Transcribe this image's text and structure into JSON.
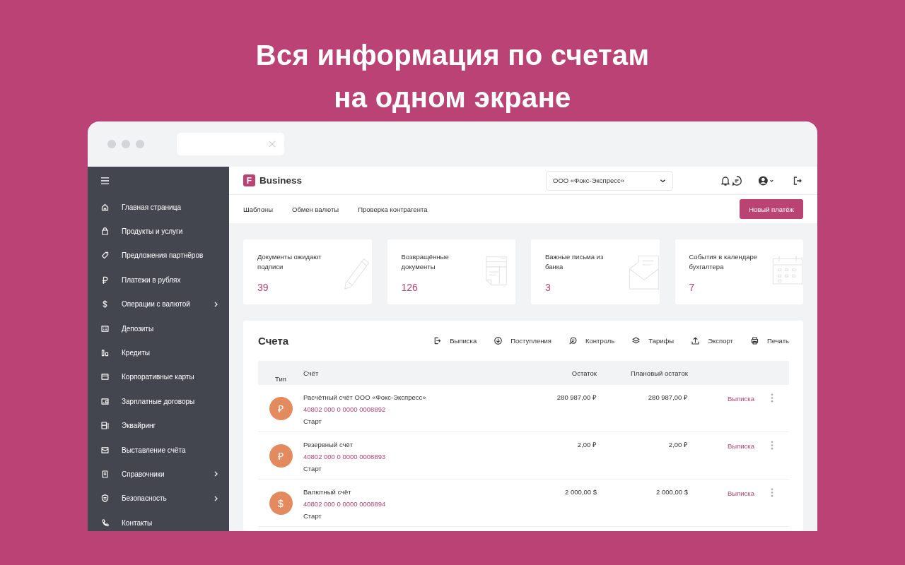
{
  "headline": [
    "Вся информация по счетам",
    "на одном экране"
  ],
  "sidebar": {
    "items": [
      {
        "label": "Главная страница",
        "has_submenu": false
      },
      {
        "label": "Продукты и услуги",
        "has_submenu": false
      },
      {
        "label": "Предложения партнёров",
        "has_submenu": false
      },
      {
        "label": "Платежи в рублях",
        "has_submenu": false
      },
      {
        "label": "Операции с валютой",
        "has_submenu": true
      },
      {
        "label": "Депозиты",
        "has_submenu": false
      },
      {
        "label": "Кредиты",
        "has_submenu": false
      },
      {
        "label": "Корпоративные карты",
        "has_submenu": false
      },
      {
        "label": "Зарплатные договоры",
        "has_submenu": false
      },
      {
        "label": "Эквайринг",
        "has_submenu": false
      },
      {
        "label": "Выставление счёта",
        "has_submenu": false
      },
      {
        "label": "Справочники",
        "has_submenu": true
      },
      {
        "label": "Безопасность",
        "has_submenu": true
      },
      {
        "label": "Контакты",
        "has_submenu": false
      }
    ]
  },
  "header": {
    "logo_mark": "F",
    "brand": "Business",
    "company_select": {
      "value": "ООО «Фокс-Экспресс»"
    }
  },
  "nav": {
    "links": [
      "Шаблоны",
      "Обмен валюты",
      "Проверка контрагента"
    ],
    "primary_button": "Новый платёж"
  },
  "cards": [
    {
      "label": "Документы ожидают подписи",
      "count": "39"
    },
    {
      "label": "Возвращённые документы",
      "count": "126"
    },
    {
      "label": "Важные письма из банка",
      "count": "3"
    },
    {
      "label": "События в календаре бухгалтера",
      "count": "7"
    }
  ],
  "accounts": {
    "title": "Счета",
    "actions": [
      "Выписка",
      "Поступления",
      "Контроль",
      "Тарифы",
      "Экспорт",
      "Печать"
    ],
    "columns": [
      "Тип",
      "Счёт",
      "Остаток",
      "Плановый остаток"
    ],
    "rows": [
      {
        "currency_symbol": "₽",
        "name": "Расчётный счёт ООО «Фокс-Экспресс»",
        "number": "40802 000 0 0000 0008892",
        "tariff": "Старт",
        "balance": "280 987,00 ₽",
        "planned_balance": "280 987,00 ₽",
        "link": "Выписка"
      },
      {
        "currency_symbol": "₽",
        "name": "Резервный счёт",
        "number": "40802 000 0 0000 0008893",
        "tariff": "Старт",
        "balance": "2,00 ₽",
        "planned_balance": "2,00 ₽",
        "link": "Выписка"
      },
      {
        "currency_symbol": "$",
        "name": "Валютный счёт",
        "number": "40802 000 0 0000 0008894",
        "tariff": "Старт",
        "balance": "2 000,00 $",
        "planned_balance": "2 000,00 $",
        "link": "Выписка"
      }
    ]
  }
}
